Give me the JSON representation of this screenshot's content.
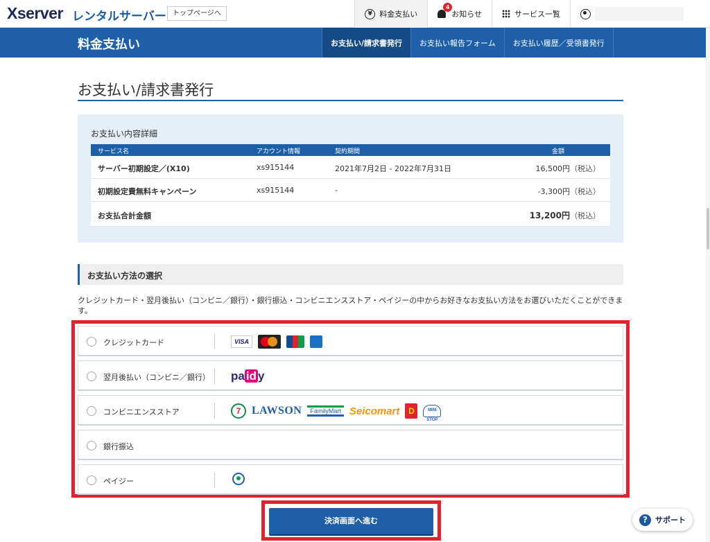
{
  "header": {
    "logo": "Xserver",
    "logo_sub": "レンタルサーバー",
    "top_page_button": "トップページへ",
    "nav": {
      "payment": "料金支払い",
      "notifications": "お知らせ",
      "notification_count": "4",
      "services": "サービス一覧"
    }
  },
  "subheader": {
    "title": "料金支払い",
    "tabs": [
      "お支払い/請求書発行",
      "お支払い報告フォーム",
      "お支払い履歴／受領書発行"
    ]
  },
  "page": {
    "title": "お支払い/請求書発行"
  },
  "details": {
    "title": "お支払い内容詳細",
    "columns": [
      "サービス名",
      "アカウント情報",
      "契約期間",
      "金額"
    ],
    "rows": [
      {
        "service": "サーバー初期設定／(X10)",
        "account": "xs915144",
        "period": "2021年7月2日 - 2022年7月31日",
        "amount": "16,500円",
        "tax": "（税込）"
      },
      {
        "service": "初期設定費無料キャンペーン",
        "account": "xs915144",
        "period": "-",
        "amount": "-3,300円",
        "tax": "（税込）"
      }
    ],
    "total": {
      "label": "お支払合計金額",
      "amount": "13,200円",
      "tax": "（税込）"
    }
  },
  "payment_method": {
    "section_title": "お支払い方法の選択",
    "description": "クレジットカード・翌月後払い（コンビニ／銀行）・銀行振込・コンビニエンスストア・ペイジーの中からお好きなお支払い方法をお選びいただくことができます。",
    "options": [
      {
        "label": "クレジットカード",
        "logos": [
          "VISA"
        ]
      },
      {
        "label": "翌月後払い（コンビニ／銀行）",
        "logos": [
          "paidy"
        ]
      },
      {
        "label": "コンビニエンスストア",
        "logos": [
          "7",
          "LAWSON",
          "FamilyMart",
          "Seicomart",
          "D",
          "MINI STOP"
        ]
      },
      {
        "label": "銀行振込",
        "logos": []
      },
      {
        "label": "ペイジー",
        "logos": []
      }
    ]
  },
  "submit_button": "決済画面へ進む",
  "support_button": "サポート",
  "colors": {
    "accent": "#1d5fa8",
    "highlight": "#e3222d"
  }
}
